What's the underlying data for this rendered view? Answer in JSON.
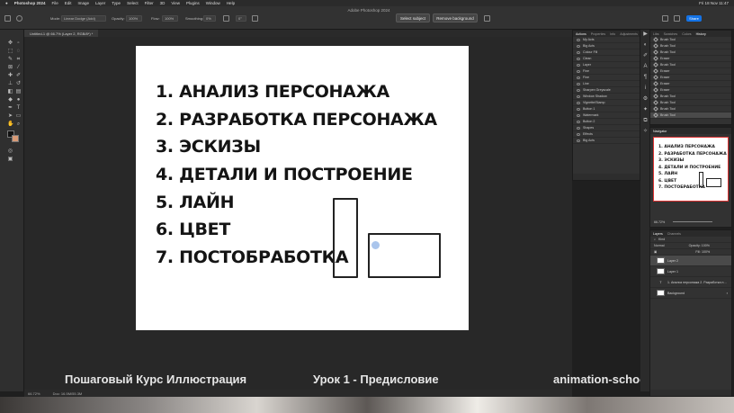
{
  "menubar": {
    "app_name": "Photoshop 2024",
    "items": [
      "File",
      "Edit",
      "Image",
      "Layer",
      "Type",
      "Select",
      "Filter",
      "3D",
      "View",
      "Plugins",
      "Window",
      "Help"
    ],
    "clock": "Fri 18 Nov 11:47"
  },
  "optbar": {
    "window_title": "Adobe Photoshop 2024",
    "mode_label": "Mode:",
    "mode_value": "Linear Dodge (Add)",
    "opacity_label": "Opacity:",
    "opacity_value": "100%",
    "flow_label": "Flow:",
    "flow_value": "100%",
    "smoothing_label": "Smoothing:",
    "smoothing_value": "0%",
    "angle_value": "0°",
    "select_subject": "Select subject",
    "remove_background": "Remove background",
    "share": "Share"
  },
  "document": {
    "tab_title": "Untitled-1 @ 66.7% (Layer 2, RGB/8*) *"
  },
  "artboard": {
    "items": [
      "1. АНАЛИЗ ПЕРСОНАЖА",
      "2. РАЗРАБОТКА ПЕРСОНАЖА",
      "3. ЭСКИЗЫ",
      "4. ДЕТАЛИ И ПОСТРОЕНИЕ",
      "5. ЛАЙН",
      "6. ЦВЕТ",
      "7. ПОСТОБРАБОТКА"
    ]
  },
  "status": {
    "zoom": "66.72%",
    "doc_size": "Doc: 16.5M/55.3M"
  },
  "captions": {
    "course": "Пошаговый Курс Иллюстрация",
    "lesson": "Урок 1 - Предисловие",
    "site": "animation-school.pro"
  },
  "actions_panel": {
    "tabs": [
      "Actions",
      "Properties",
      "Info",
      "Adjustments"
    ],
    "rows": [
      "My Acts",
      "Big Acts",
      "Colour Fill",
      "Clean",
      "Layer",
      "Fine",
      "Fine",
      "Line",
      "Sharpen Greyscale",
      "Window Shadow",
      "Vignette/Stamp",
      "Button 1",
      "Watermark",
      "Button 2",
      "Shapes",
      "Effects",
      "Big Acts"
    ]
  },
  "history_panel": {
    "tabs": [
      "Libs",
      "Swatches",
      "Colors",
      "History"
    ],
    "rows": [
      "Brush Tool",
      "Brush Tool",
      "Brush Tool",
      "Eraser",
      "Brush Tool",
      "Eraser",
      "Eraser",
      "Eraser",
      "Eraser",
      "Brush Tool",
      "Brush Tool",
      "Brush Tool",
      "Brush Tool"
    ]
  },
  "navigator": {
    "title": "Navigator",
    "zoom": "66.72%"
  },
  "layers_panel": {
    "tabs": [
      "Layers",
      "Channels"
    ],
    "kind_label": "Kind",
    "blend_mode": "Normal",
    "opacity": "Opacity: 100%",
    "fill": "Fill: 100%",
    "layers": [
      "Layer 2",
      "Layer 1",
      "1. Анализ персонажа 2. Разработка персонажа 3. Эскизы 4. Детали",
      "Background"
    ]
  }
}
